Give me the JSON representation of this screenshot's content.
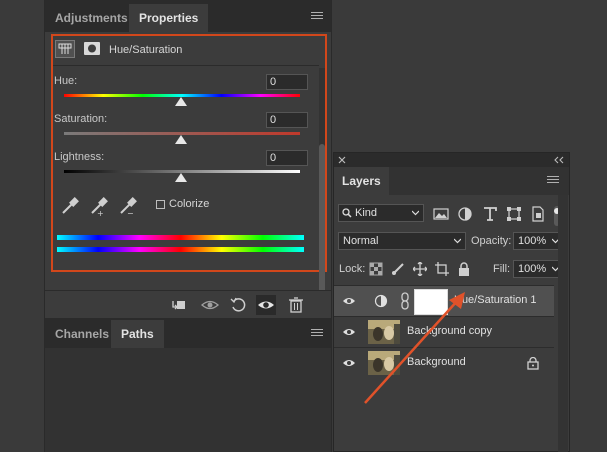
{
  "left_panel": {
    "tabs": [
      {
        "label": "Adjustments",
        "active": false
      },
      {
        "label": "Properties",
        "active": true
      }
    ],
    "properties": {
      "title": "Hue/Saturation",
      "hue": {
        "label": "Hue:",
        "value": "0"
      },
      "saturation": {
        "label": "Saturation:",
        "value": "0"
      },
      "lightness": {
        "label": "Lightness:",
        "value": "0"
      },
      "colorize_label": "Colorize",
      "colorize_checked": false
    },
    "toolbar_icons": [
      "clip-to-layer-icon",
      "view-previous-state-icon",
      "reset-icon",
      "visibility-eye-icon",
      "trash-icon"
    ]
  },
  "bottom_panel": {
    "tabs": [
      {
        "label": "Channels",
        "active": false
      },
      {
        "label": "Paths",
        "active": true
      }
    ]
  },
  "layers_panel": {
    "tab_label": "Layers",
    "filter": {
      "label": "Kind"
    },
    "filter_icons": [
      "pixel-filter-icon",
      "adjustment-filter-icon",
      "type-filter-icon",
      "shape-filter-icon",
      "smart-object-filter-icon",
      "filter-toggle-icon"
    ],
    "blend_mode": "Normal",
    "opacity_label": "Opacity:",
    "opacity_value": "100%",
    "lock_label": "Lock:",
    "fill_label": "Fill:",
    "fill_value": "100%",
    "layers": [
      {
        "name": "Hue/Saturation 1",
        "selected": true,
        "type": "adjustment"
      },
      {
        "name": "Background copy",
        "selected": false,
        "type": "image"
      },
      {
        "name": "Background",
        "selected": false,
        "type": "image",
        "locked": true
      }
    ]
  },
  "colors": {
    "highlight_border": "#d2471b",
    "annotation_arrow": "#e0522a"
  }
}
